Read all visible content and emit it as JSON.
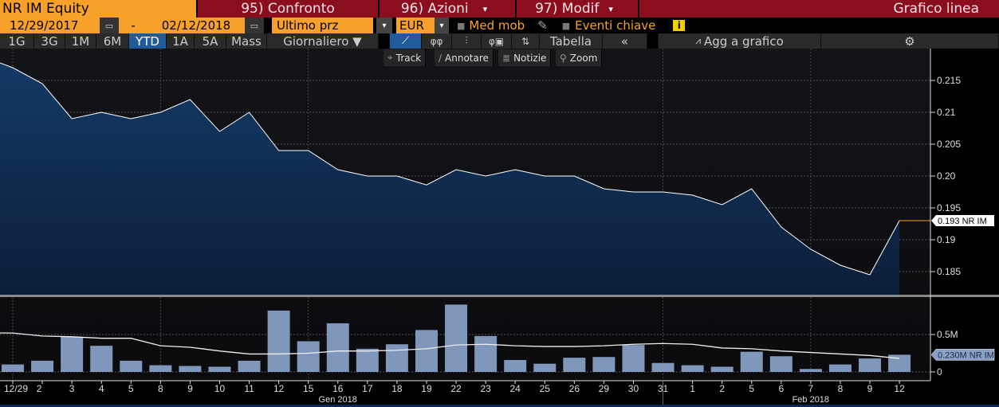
{
  "header": {
    "security": "NR IM Equity",
    "menus": [
      {
        "label": "95) Confronto"
      },
      {
        "label": "96) Azioni"
      },
      {
        "label": "97) Modif"
      }
    ],
    "title": "Grafico linea"
  },
  "controls": {
    "start_date": "12/29/2017",
    "separator": "-",
    "end_date": "02/12/2018",
    "field": "Ultimo prz",
    "currency": "EUR",
    "moving_avg": "Med mob",
    "key_events": "Eventi chiave",
    "info": "i"
  },
  "toolbar": {
    "periods": [
      "1G",
      "3G",
      "1M",
      "6M",
      "YTD",
      "1A",
      "5A",
      "Mass"
    ],
    "active_period": "YTD",
    "frequency": "Giornaliero ▼",
    "table": "Tabella",
    "collapse": "«",
    "add_to_chart": "Agg a grafico"
  },
  "chart_tools": [
    "Track",
    "Annotare",
    "Notizie",
    "Zoom"
  ],
  "colors": {
    "header_orange": "#f7a12b",
    "header_red": "#8b0e1f",
    "area_fill": "#0f2d52",
    "line": "#ffffff",
    "volume_bar": "#7f97bb",
    "active_tab": "#1f5a99"
  },
  "chart_data": [
    {
      "type": "area",
      "categories": [
        "12/29",
        "2",
        "3",
        "4",
        "5",
        "8",
        "9",
        "10",
        "11",
        "12",
        "15",
        "16",
        "17",
        "18",
        "19",
        "22",
        "23",
        "24",
        "25",
        "26",
        "29",
        "30",
        "31",
        "1",
        "2",
        "5",
        "6",
        "7",
        "8",
        "9",
        "12"
      ],
      "values": [
        0.217,
        0.2145,
        0.209,
        0.21,
        0.209,
        0.21,
        0.212,
        0.207,
        0.21,
        0.204,
        0.204,
        0.201,
        0.2,
        0.2,
        0.1986,
        0.201,
        0.2,
        0.201,
        0.2,
        0.2,
        0.198,
        0.1975,
        0.1975,
        0.197,
        0.1955,
        0.198,
        0.192,
        0.1885,
        0.186,
        0.1845,
        0.193
      ],
      "yticks": [
        "0.215",
        "0.21",
        "0.205",
        "0.20",
        "0.195",
        "0.19",
        "0.185"
      ],
      "ylim": [
        0.1815,
        0.2195
      ],
      "grid": true,
      "last_label": "0.193 NR IM",
      "month_labels": [
        "Gen 2018",
        "Feb 2018"
      ]
    },
    {
      "type": "bar",
      "unit": "M",
      "values": [
        0.1,
        0.15,
        0.47,
        0.35,
        0.15,
        0.09,
        0.08,
        0.07,
        0.15,
        0.82,
        0.41,
        0.65,
        0.31,
        0.37,
        0.56,
        0.9,
        0.48,
        0.16,
        0.11,
        0.19,
        0.2,
        0.36,
        0.12,
        0.09,
        0.07,
        0.27,
        0.21,
        0.04,
        0.1,
        0.18,
        0.23
      ],
      "moving_average": [
        0.52,
        0.48,
        0.47,
        0.45,
        0.45,
        0.35,
        0.33,
        0.28,
        0.24,
        0.24,
        0.25,
        0.28,
        0.28,
        0.29,
        0.31,
        0.36,
        0.37,
        0.35,
        0.34,
        0.34,
        0.35,
        0.37,
        0.38,
        0.37,
        0.32,
        0.31,
        0.28,
        0.26,
        0.24,
        0.22,
        0.18
      ],
      "yticks": [
        "0.5M",
        "0"
      ],
      "last_label": "0.230M NR IM"
    }
  ]
}
